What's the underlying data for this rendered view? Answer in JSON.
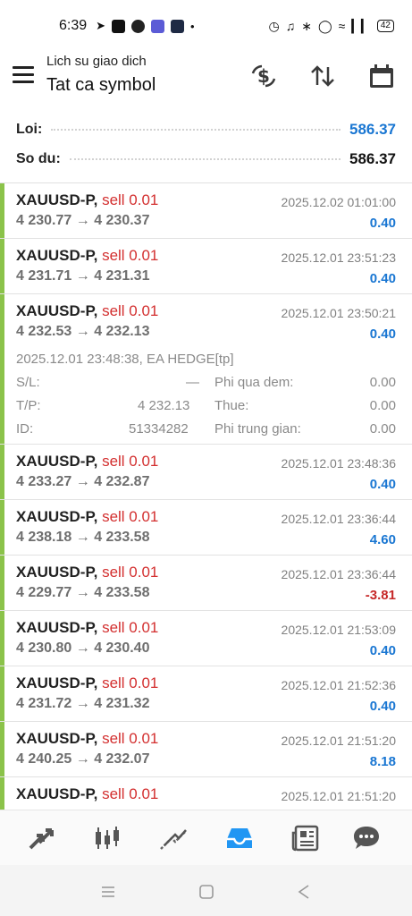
{
  "status_bar": {
    "time": "6:39",
    "battery": "42"
  },
  "header": {
    "subtitle": "Lich su giao dich",
    "title": "Tat ca symbol",
    "icons": [
      "currency-exchange-icon",
      "sort-arrows-icon",
      "calendar-icon"
    ]
  },
  "summary": {
    "profit_label": "Loi:",
    "profit_value": "586.37",
    "balance_label": "So du:",
    "balance_value": "586.37",
    "profit_color": "#1976d2"
  },
  "deals": [
    {
      "symbol": "XAUUSD-P,",
      "side": "sell 0.01",
      "open": "4 230.77",
      "close": "4 230.37",
      "time": "2025.12.02 01:01:00",
      "profit": "0.40",
      "positive": true
    },
    {
      "symbol": "XAUUSD-P,",
      "side": "sell 0.01",
      "open": "4 231.71",
      "close": "4 231.31",
      "time": "2025.12.01 23:51:23",
      "profit": "0.40",
      "positive": true
    },
    {
      "symbol": "XAUUSD-P,",
      "side": "sell 0.01",
      "open": "4 232.53",
      "close": "4 232.13",
      "time": "2025.12.01 23:50:21",
      "profit": "0.40",
      "positive": true
    },
    {
      "symbol": "XAUUSD-P,",
      "side": "sell 0.01",
      "open": "4 233.27",
      "close": "4 232.87",
      "time": "2025.12.01 23:48:36",
      "profit": "0.40",
      "positive": true
    },
    {
      "symbol": "XAUUSD-P,",
      "side": "sell 0.01",
      "open": "4 238.18",
      "close": "4 233.58",
      "time": "2025.12.01 23:36:44",
      "profit": "4.60",
      "positive": true
    },
    {
      "symbol": "XAUUSD-P,",
      "side": "sell 0.01",
      "open": "4 229.77",
      "close": "4 233.58",
      "time": "2025.12.01 23:36:44",
      "profit": "-3.81",
      "positive": false
    },
    {
      "symbol": "XAUUSD-P,",
      "side": "sell 0.01",
      "open": "4 230.80",
      "close": "4 230.40",
      "time": "2025.12.01 21:53:09",
      "profit": "0.40",
      "positive": true
    },
    {
      "symbol": "XAUUSD-P,",
      "side": "sell 0.01",
      "open": "4 231.72",
      "close": "4 231.32",
      "time": "2025.12.01 21:52:36",
      "profit": "0.40",
      "positive": true
    },
    {
      "symbol": "XAUUSD-P,",
      "side": "sell 0.01",
      "open": "4 240.25",
      "close": "4 232.07",
      "time": "2025.12.01 21:51:20",
      "profit": "8.18",
      "positive": true
    },
    {
      "symbol": "XAUUSD-P,",
      "side": "sell 0.01",
      "open": "",
      "close": "",
      "time": "2025.12.01 21:51:20",
      "profit": "",
      "positive": true
    }
  ],
  "expanded_detail": {
    "open_line": "2025.12.01 23:48:38, EA HEDGE[tp]",
    "sl_label": "S/L:",
    "sl_value": "—",
    "tp_label": "T/P:",
    "tp_value": "4 232.13",
    "id_label": "ID:",
    "id_value": "51334282",
    "swap_label": "Phi qua dem:",
    "swap_value": "0.00",
    "tax_label": "Thue:",
    "tax_value": "0.00",
    "commission_label": "Phi trung gian:",
    "commission_value": "0.00"
  },
  "arrow": "→",
  "colors": {
    "positive": "#1976d2",
    "negative": "#c62828",
    "side": "#d32f2f",
    "accent_bar": "#8bc34a",
    "nav_active": "#2196f3"
  },
  "bottom_nav": [
    "quotes-icon",
    "chart-icon",
    "trade-icon",
    "history-icon",
    "news-icon",
    "chat-icon"
  ]
}
